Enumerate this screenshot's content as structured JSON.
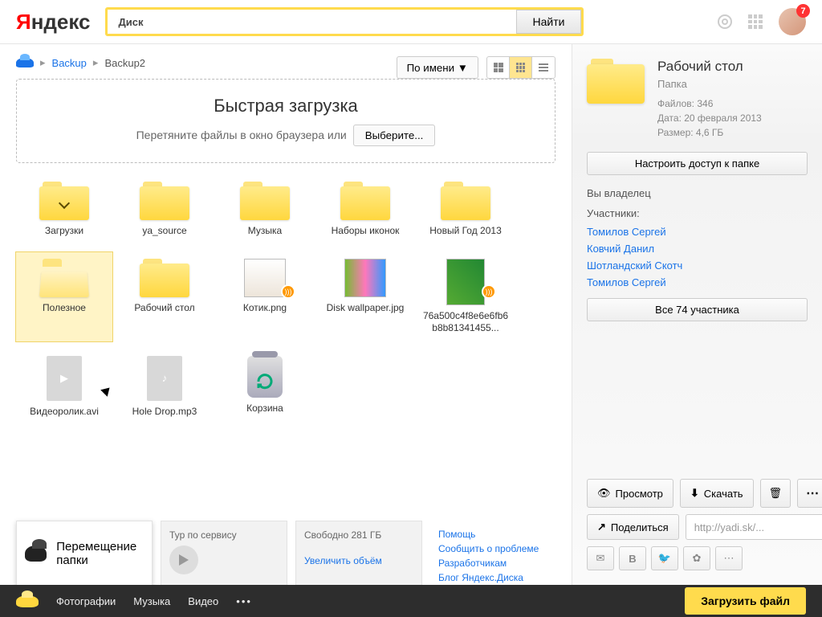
{
  "header": {
    "logo_pre": "Я",
    "logo_rest": "ндекс",
    "search_label": "Диск",
    "search_btn": "Найти",
    "badge": "7"
  },
  "crumbs": {
    "root": "Backup",
    "current": "Backup2",
    "sep": "▸"
  },
  "sort": "По имени ▼",
  "dropzone": {
    "title": "Быстрая загрузка",
    "sub": "Перетяните файлы в окно браузера или",
    "choose": "Выберите..."
  },
  "items": [
    {
      "name": "Загрузки",
      "kind": "folder",
      "dl": true
    },
    {
      "name": "ya_source",
      "kind": "folder"
    },
    {
      "name": "Музыка",
      "kind": "folder"
    },
    {
      "name": "Наборы иконок",
      "kind": "folder"
    },
    {
      "name": "Новый Год 2013",
      "kind": "folder"
    },
    {
      "name": "Полезное",
      "kind": "folder",
      "open": true,
      "selected": true
    },
    {
      "name": "Рабочий стол",
      "kind": "folder"
    },
    {
      "name": "Котик.png",
      "kind": "image",
      "cls": "cat",
      "audio": true
    },
    {
      "name": "Disk wallpaper.jpg",
      "kind": "image",
      "cls": "wall"
    },
    {
      "name": "76a500c4f8e6e6fb6b8b81341455...",
      "kind": "image",
      "cls": "port",
      "audio": true
    },
    {
      "name": "Видеоролик.avi",
      "kind": "video"
    },
    {
      "name": "Hole Drop.mp3",
      "kind": "audio"
    },
    {
      "name": "Корзина",
      "kind": "trash"
    }
  ],
  "moving": "Перемещение папки",
  "tour": "Typ по сервису",
  "space": {
    "free": "Свободно 281 ГБ",
    "enlarge": "Увеличить объём"
  },
  "help": [
    "Помощь",
    "Сообщить о проблеме",
    "Разработчикам",
    "Блог Яндекс.Диска"
  ],
  "side": {
    "title": "Рабочий стол",
    "type": "Папка",
    "files": "Файлов: 346",
    "date": "Дата: 20 февраля 2013",
    "size": "Размер: 4,6 ГБ",
    "access_btn": "Настроить доступ к папке",
    "owner": "Вы владелец",
    "participants_lbl": "Участники:",
    "participants": [
      "Томилов Сергей",
      "Ковчий Данил",
      "Шотландский Скотч",
      "Томилов Сергей"
    ],
    "all_btn": "Все 74 участника",
    "preview": "Просмотр",
    "download": "Скачать",
    "share": "Поделиться",
    "share_url": "http://yadi.sk/..."
  },
  "bottom": {
    "photos": "Фотографии",
    "music": "Музыка",
    "video": "Видео",
    "upload": "Загрузить файл"
  }
}
